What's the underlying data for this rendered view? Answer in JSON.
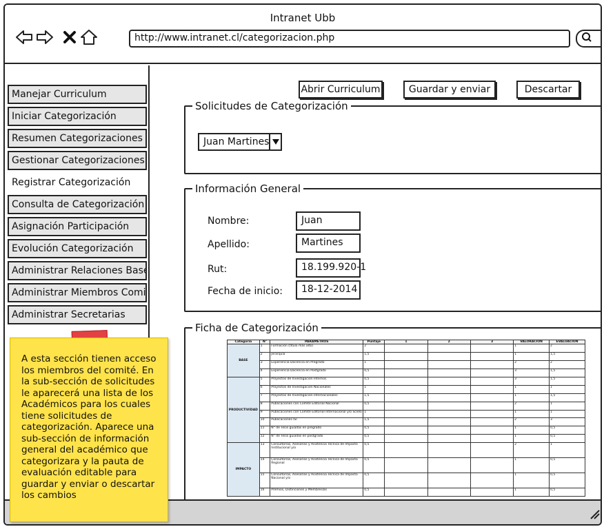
{
  "window": {
    "title": "Intranet Ubb",
    "url": "http://www.intranet.cl/categorizacion.php"
  },
  "icons": {
    "back": "arrow-left-icon",
    "forward": "arrow-right-icon",
    "close": "x-icon",
    "home": "home-icon",
    "search": "search-icon",
    "resize": "resize-grip-icon"
  },
  "sidebar": {
    "items": [
      {
        "label": "Manejar Curriculum"
      },
      {
        "label": "Iniciar Categorización"
      },
      {
        "label": "Resumen Categorizaciones"
      },
      {
        "label": "Gestionar Categorizaciones"
      },
      {
        "label": "Registrar Categorización"
      },
      {
        "label": "Consulta de Categorización"
      },
      {
        "label": "Asignación Participación"
      },
      {
        "label": "Evolución Categorización"
      },
      {
        "label": "Administrar Relaciones Base"
      },
      {
        "label": "Administrar Miembros Comite"
      },
      {
        "label": "Administrar Secretarias"
      }
    ],
    "active_index": 4
  },
  "note": {
    "text": "A esta sección tienen acceso los miembros del comité. En la sub-sección de solicitudes le aparecerá una lista de los Académicos para los cuales tiene solicitudes de categorización. Aparece una sub-sección de información general del académico que categorizara y la pauta de evaluación editable para guardar y enviar o descartar los cambios"
  },
  "toolbar": {
    "open_label": "Abrir Curriculum",
    "save_label": "Guardar y enviar",
    "discard_label": "Descartar"
  },
  "solicitudes": {
    "legend": "Solicitudes de Categorización",
    "selected": "Juan Martines"
  },
  "info": {
    "legend": "Información General",
    "fields": [
      {
        "label": "Nombre:",
        "value": "Juan"
      },
      {
        "label": "Apellido:",
        "value": "Martines"
      },
      {
        "label": "Rut:",
        "value": "18.199.920-1"
      },
      {
        "label": "Fecha de inicio:",
        "value": "18-12-2014"
      }
    ]
  },
  "ficha": {
    "legend": "Ficha de Categorización",
    "headers": [
      "Categoría",
      "N°",
      "PARÁMETROS",
      "Puntaje",
      "1",
      "2",
      "3",
      "VALORACIÓN",
      "EVALUACIÓN"
    ],
    "sections": [
      {
        "category": "BASE",
        "rows": [
          [
            "1",
            "Formación (título más alto)",
            "2",
            "",
            "",
            "",
            "1",
            "2"
          ],
          [
            "2",
            "Jerarquía",
            "1,5",
            "",
            "",
            "",
            "1",
            "1,5"
          ],
          [
            "3",
            "Experiencia Docencia en Pregrado",
            "1",
            "",
            "",
            "",
            "2",
            "2"
          ],
          [
            "4",
            "Experiencia Docencia en Postgrado",
            "0,5",
            "",
            "",
            "",
            "3",
            "1,5"
          ]
        ]
      },
      {
        "category": "PRODUCTIVIDAD",
        "rows": [
          [
            "5",
            "Proyectos de Investigación Internos",
            "0,5",
            "",
            "",
            "",
            "3",
            "1,5"
          ],
          [
            "6",
            "Proyectos de Investigación Nacionales",
            "1",
            "",
            "",
            "",
            "1",
            "1"
          ],
          [
            "7",
            "Proyectos de Investigación Internacionales",
            "1,5",
            "",
            "",
            "",
            "1",
            "1,5"
          ],
          [
            "8",
            "Publicaciones con Comité Editorial Nacional",
            "0,5",
            "",
            "",
            "",
            "2",
            "1"
          ],
          [
            "9",
            "Publicaciones con Comité Editorial Internacional y/o Scielo",
            "1",
            "",
            "",
            "",
            "1",
            "1"
          ],
          [
            "10",
            "Publicaciones ISI",
            "1,5",
            "",
            "",
            "",
            "2",
            "3"
          ],
          [
            "11",
            "N° de Tesis guiadas en pregrado",
            "0,5",
            "",
            "",
            "",
            "1",
            "0,5"
          ],
          [
            "12",
            "N° de Tesis guiadas en postgrado",
            "0,5",
            "",
            "",
            "",
            "1",
            "0,5"
          ]
        ]
      },
      {
        "category": "IMPACTO",
        "rows": [
          [
            "13",
            "Consultorías, Asesorías y Asistencia Técnica de Impacto Institucional y/o",
            "0,5",
            "",
            "",
            "",
            "2",
            "1"
          ],
          [
            "14",
            "Consultorías, Asesorías y Asistencia Técnica de Impacto Regional",
            "0,5",
            "",
            "",
            "",
            "1",
            "0,5"
          ],
          [
            "15",
            "Consultorías, Asesorías y Asistencia Técnica de Impacto Nacional y/o",
            "0,5",
            "",
            "",
            "",
            "1",
            "0,5"
          ],
          [
            "16",
            "Premios, Distinciones y Membresías",
            "0,5",
            "",
            "",
            "",
            "1",
            "0,5"
          ]
        ]
      }
    ]
  }
}
